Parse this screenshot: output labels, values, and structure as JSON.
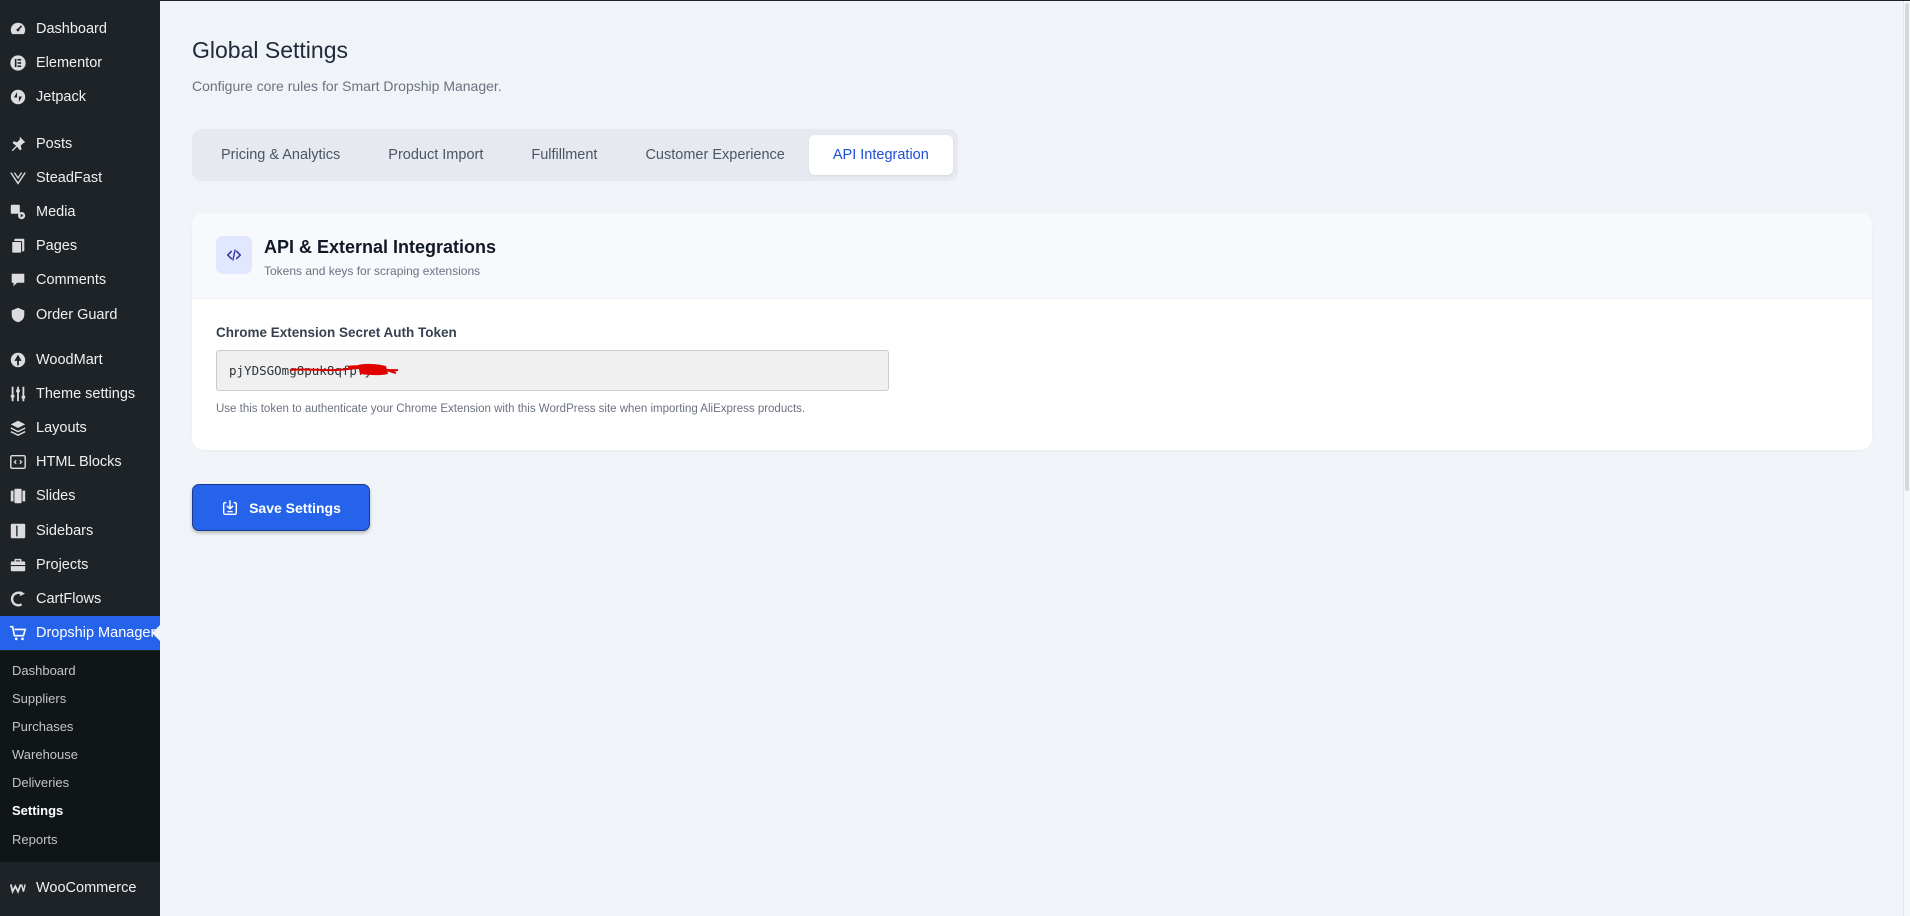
{
  "sidebar": {
    "menu": [
      {
        "label": "Dashboard",
        "icon": "dashboard-icon"
      },
      {
        "label": "Elementor",
        "icon": "elementor-icon"
      },
      {
        "label": "Jetpack",
        "icon": "jetpack-icon"
      },
      {
        "label": "Posts",
        "icon": "pin-icon"
      },
      {
        "label": "SteadFast",
        "icon": "steadfast-icon"
      },
      {
        "label": "Media",
        "icon": "media-icon"
      },
      {
        "label": "Pages",
        "icon": "pages-icon"
      },
      {
        "label": "Comments",
        "icon": "comment-icon"
      },
      {
        "label": "Order Guard",
        "icon": "shield-icon"
      },
      {
        "label": "WoodMart",
        "icon": "tree-icon"
      },
      {
        "label": "Theme settings",
        "icon": "sliders-icon"
      },
      {
        "label": "Layouts",
        "icon": "layers-icon"
      },
      {
        "label": "HTML Blocks",
        "icon": "code-block-icon"
      },
      {
        "label": "Slides",
        "icon": "slides-icon"
      },
      {
        "label": "Sidebars",
        "icon": "sidebar-panel-icon"
      },
      {
        "label": "Projects",
        "icon": "briefcase-icon"
      },
      {
        "label": "CartFlows",
        "icon": "cartflows-icon"
      },
      {
        "label": "Dropship Manager",
        "icon": "cart-icon"
      },
      {
        "label": "WooCommerce",
        "icon": "woocommerce-icon"
      }
    ],
    "submenu": [
      {
        "label": "Dashboard"
      },
      {
        "label": "Suppliers"
      },
      {
        "label": "Purchases"
      },
      {
        "label": "Warehouse"
      },
      {
        "label": "Deliveries"
      },
      {
        "label": "Settings"
      },
      {
        "label": "Reports"
      }
    ]
  },
  "page": {
    "title": "Global Settings",
    "subtitle": "Configure core rules for Smart Dropship Manager."
  },
  "tabs": [
    {
      "label": "Pricing & Analytics"
    },
    {
      "label": "Product Import"
    },
    {
      "label": "Fulfillment"
    },
    {
      "label": "Customer Experience"
    },
    {
      "label": "API Integration"
    }
  ],
  "card": {
    "icon": "code-icon",
    "title": "API & External Integrations",
    "description": "Tokens and keys for scraping extensions",
    "field_label": "Chrome Extension Secret Auth Token",
    "token_value": "pjYDSGOmg8puk8qfpfy",
    "help_text": "Use this token to authenticate your Chrome Extension with this WordPress site when importing AliExpress products."
  },
  "actions": {
    "save_label": "Save Settings",
    "save_icon": "save-download-icon"
  },
  "colors": {
    "sidebar_bg": "#1d2327",
    "submenu_bg": "#101517",
    "accent": "#2563eb",
    "page_bg": "#f0f3f8",
    "active_tab_text": "#1d4ed8",
    "redaction": "#e00000"
  }
}
